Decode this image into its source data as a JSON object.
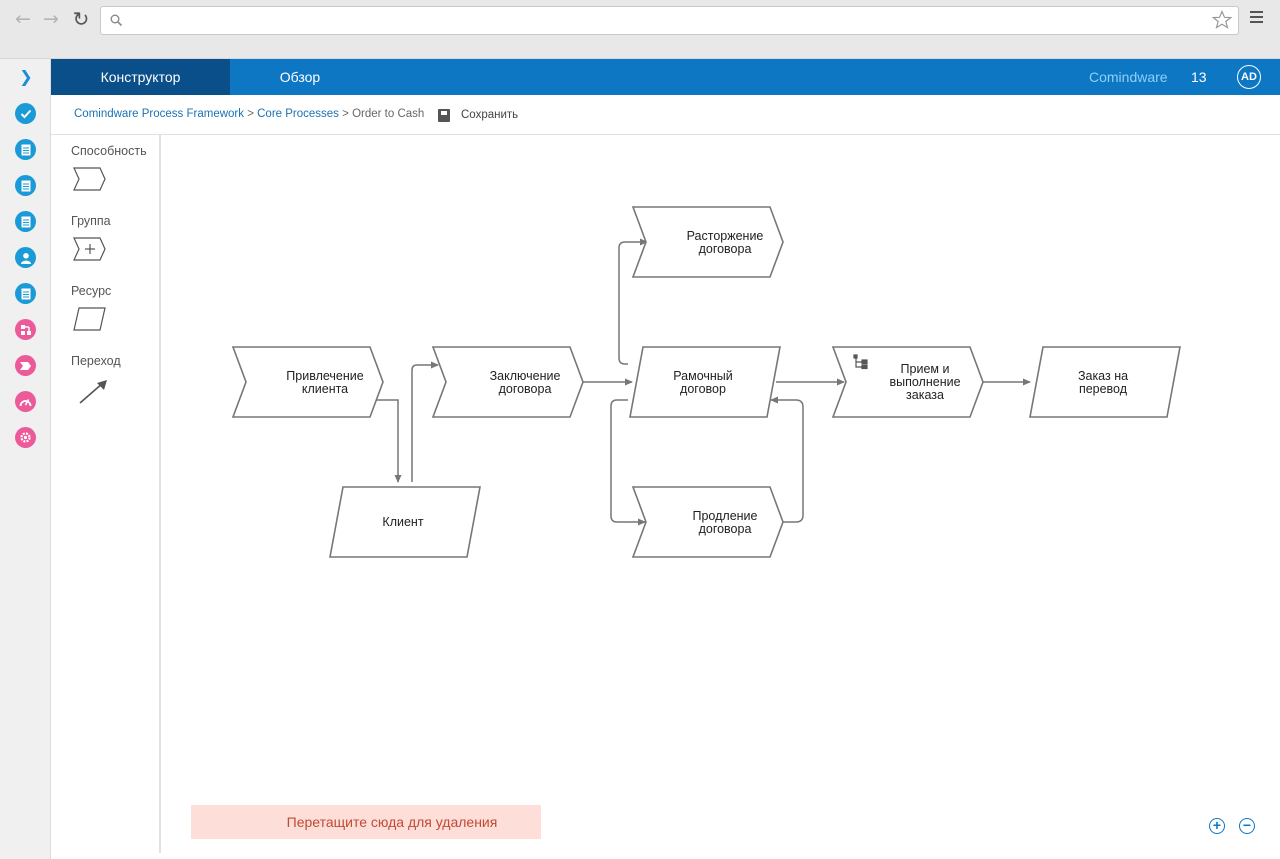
{
  "browser": {
    "back_icon": "arrow-left-icon",
    "forward_icon": "arrow-right-icon",
    "reload_icon": "reload-icon",
    "search_icon": "search-icon",
    "address_value": "",
    "bookmark_icon": "star-icon",
    "menu_icon": "hamburger-menu-icon"
  },
  "rail": {
    "toggle_icon": "chevron-right-icon",
    "items": [
      {
        "icon": "check-circle-icon",
        "color": "#1a9ad6"
      },
      {
        "icon": "document-icon",
        "color": "#1a9ad6"
      },
      {
        "icon": "document-icon",
        "color": "#1a9ad6"
      },
      {
        "icon": "document-icon",
        "color": "#1a9ad6"
      },
      {
        "icon": "user-icon",
        "color": "#1a9ad6"
      },
      {
        "icon": "document-icon",
        "color": "#1a9ad6"
      },
      {
        "icon": "hierarchy-icon",
        "color": "#ec5a9a"
      },
      {
        "icon": "process-arrow-icon",
        "color": "#ec5a9a"
      },
      {
        "icon": "gauge-icon",
        "color": "#ec5a9a"
      },
      {
        "icon": "gear-icon",
        "color": "#ec5a9a"
      }
    ]
  },
  "header": {
    "tabs": [
      {
        "label": "Конструктор",
        "active": true
      },
      {
        "label": "Обзор",
        "active": false
      }
    ],
    "brand": "Comindware",
    "count": "13",
    "avatar": "AD",
    "colors": {
      "bar": "#0d77c4",
      "active_tab": "#0a4f8a",
      "brand": "#8fd0f6"
    }
  },
  "breadcrumb": {
    "items": [
      "Comindware Process Framework",
      "Core Processes",
      "Order to Cash"
    ],
    "separator": ">",
    "save_label": "Сохранить",
    "save_icon": "floppy-disk-icon"
  },
  "palette": {
    "items": [
      {
        "label": "Способность",
        "icon": "chevron-shape-icon"
      },
      {
        "label": "Группа",
        "icon": "chevron-plus-shape-icon"
      },
      {
        "label": "Ресурс",
        "icon": "parallelogram-shape-icon"
      },
      {
        "label": "Переход",
        "icon": "arrow-icon"
      }
    ]
  },
  "diagram": {
    "nodes": [
      {
        "id": "attract",
        "type": "capability-start",
        "lines": [
          "Привлечение",
          "клиента"
        ]
      },
      {
        "id": "contract",
        "type": "capability",
        "lines": [
          "Заключение",
          "договора"
        ]
      },
      {
        "id": "client",
        "type": "resource",
        "lines": [
          "Клиент"
        ]
      },
      {
        "id": "framework",
        "type": "resource",
        "lines": [
          "Рамочный",
          "договор"
        ]
      },
      {
        "id": "terminate",
        "type": "capability",
        "lines": [
          "Расторжение",
          "договора"
        ]
      },
      {
        "id": "extend",
        "type": "capability",
        "lines": [
          "Продление",
          "договора"
        ]
      },
      {
        "id": "fulfill",
        "type": "group",
        "lines": [
          "Прием и",
          "выполнение",
          "заказа"
        ]
      },
      {
        "id": "transfer",
        "type": "resource",
        "lines": [
          "Заказ на",
          "перевод"
        ]
      }
    ],
    "edges": [
      {
        "from": "attract",
        "to": "client"
      },
      {
        "from": "client",
        "to": "contract"
      },
      {
        "from": "contract",
        "to": "framework"
      },
      {
        "from": "framework",
        "to": "terminate"
      },
      {
        "from": "framework",
        "to": "extend"
      },
      {
        "from": "extend",
        "to": "framework"
      },
      {
        "from": "framework",
        "to": "fulfill"
      },
      {
        "from": "fulfill",
        "to": "transfer"
      }
    ],
    "stroke_color": "#777777"
  },
  "drop_zone": {
    "label": "Перетащите сюда для удаления",
    "color": "#fdded8",
    "text_color": "#c14b35"
  },
  "zoom": {
    "in_icon": "zoom-in-icon",
    "out_icon": "zoom-out-icon"
  }
}
